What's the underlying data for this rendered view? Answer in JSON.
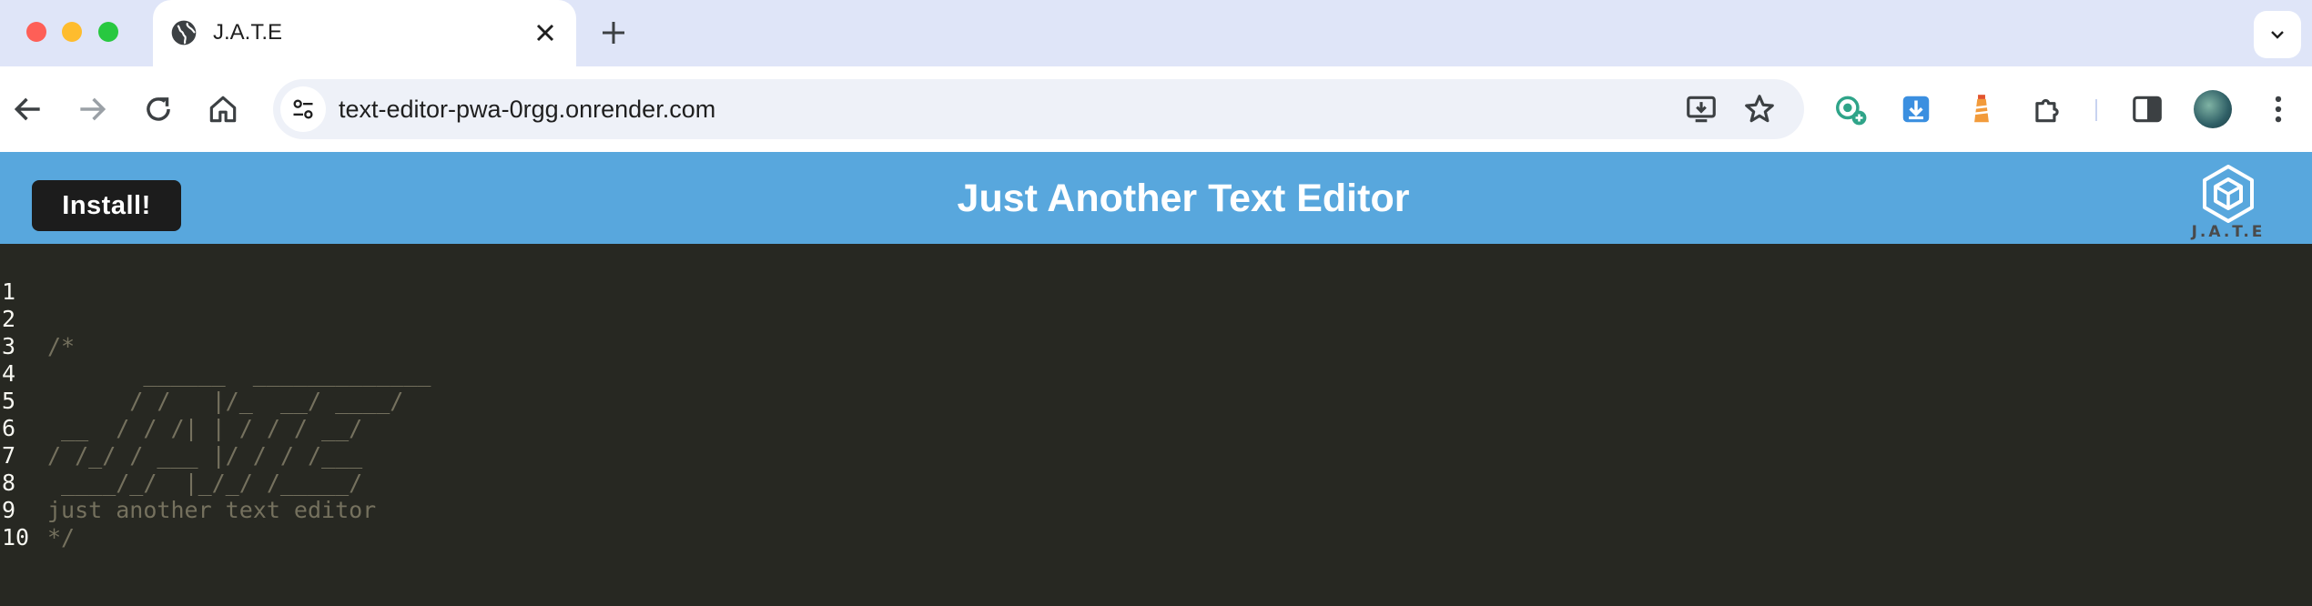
{
  "browser": {
    "tab": {
      "title": "J.A.T.E"
    },
    "address_bar": {
      "url": "text-editor-pwa-0rgg.onrender.com"
    },
    "icons": {
      "tab_favicon": "globe-icon",
      "close": "close-icon",
      "new_tab": "plus-icon",
      "tab_search": "chevron-down-icon",
      "back": "arrow-left-icon",
      "forward": "arrow-right-icon",
      "reload": "reload-icon",
      "home": "home-icon",
      "site_info": "tune-icon",
      "install_app": "install-app-icon",
      "bookmark": "star-icon",
      "side_panel": "side-panel-icon",
      "menu": "more-vertical-icon"
    }
  },
  "app": {
    "install_label": "Install!",
    "title": "Just Another Text Editor",
    "logo_text": "J.A.T.E",
    "colors": {
      "header": "#58a7dd",
      "editor_bg": "#272822",
      "comment": "#75715e",
      "line_number": "#f8f8f2"
    }
  },
  "editor": {
    "lines": [
      {
        "num": "1",
        "text": ""
      },
      {
        "num": "2",
        "text": "/*"
      },
      {
        "num": "3",
        "text": "       ______  _____________"
      },
      {
        "num": "4",
        "text": "      / /   |/_  __/ ____/"
      },
      {
        "num": "5",
        "text": " __  / / /| | / / / __/"
      },
      {
        "num": "6",
        "text": "/ /_/ / ___ |/ / / /___"
      },
      {
        "num": "7",
        "text": " ____/_/  |_/_/ /_____/"
      },
      {
        "num": "8",
        "text": "just another text editor"
      },
      {
        "num": "9",
        "text": "*/"
      },
      {
        "num": "10",
        "text": ""
      }
    ]
  }
}
